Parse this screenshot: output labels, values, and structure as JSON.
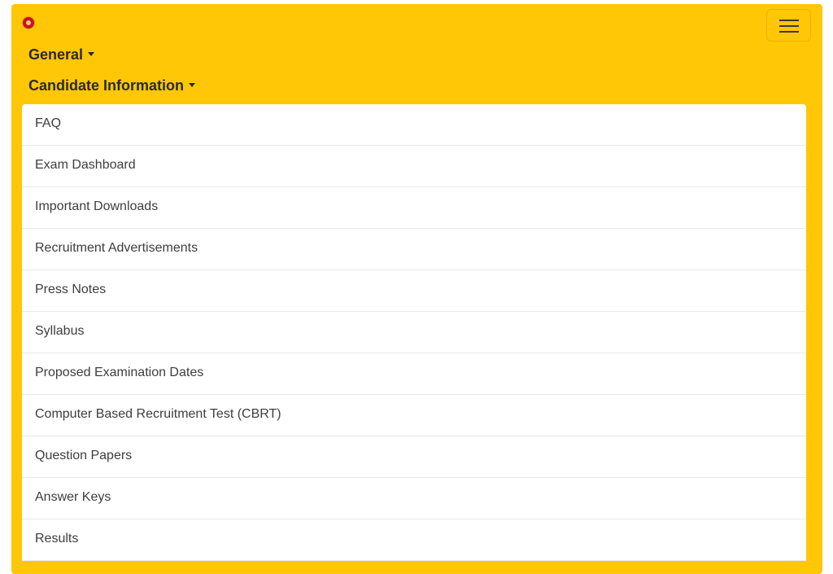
{
  "navbar": {
    "logo": "emblem-logo",
    "toggle_icon": "hamburger-icon",
    "dropdowns": [
      {
        "label": "General"
      },
      {
        "label": "Candidate Information"
      }
    ]
  },
  "menu": {
    "items": [
      "FAQ",
      "Exam Dashboard",
      "Important Downloads",
      "Recruitment Advertisements",
      "Press Notes",
      "Syllabus",
      "Proposed Examination Dates",
      "Computer Based Recruitment Test (CBRT)",
      "Question Papers",
      "Answer Keys",
      "Results"
    ]
  },
  "colors": {
    "navbar_background": "#ffc705",
    "menu_background": "#ffffff",
    "text": "#3d3d3d"
  }
}
